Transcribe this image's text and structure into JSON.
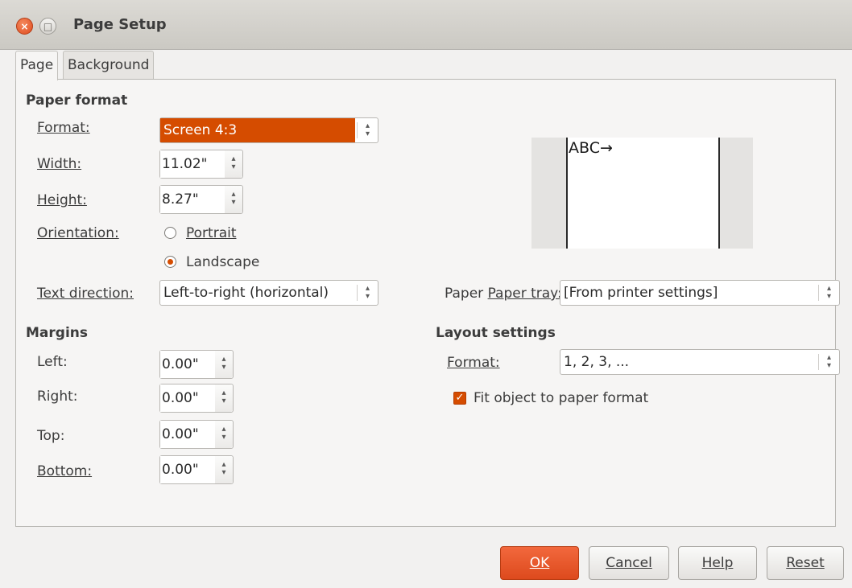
{
  "window": {
    "title": "Page Setup",
    "close_glyph": "×",
    "maximize_glyph": "□"
  },
  "tabs": [
    {
      "label": "Page",
      "active": true
    },
    {
      "label": "Background",
      "active": false
    }
  ],
  "paper_format": {
    "heading": "Paper format",
    "format_label": "Format:",
    "format_value": "Screen 4:3",
    "width_label": "Width:",
    "width_value": "11.02\"",
    "height_label": "Height:",
    "height_value": "8.27\"",
    "orientation_label": "Orientation:",
    "portrait_label": "Portrait",
    "landscape_label": "Landscape",
    "orientation_selected": "Landscape",
    "text_direction_label": "Text direction:",
    "text_direction_value": "Left-to-right (horizontal)",
    "paper_tray_label": "Paper tray:",
    "paper_tray_value": "[From printer settings]"
  },
  "preview": {
    "text": "ABC→"
  },
  "margins": {
    "heading": "Margins",
    "left_label": "Left:",
    "left_value": "0.00\"",
    "right_label": "Right:",
    "right_value": "0.00\"",
    "top_label": "Top:",
    "top_value": "0.00\"",
    "bottom_label": "Bottom:",
    "bottom_value": "0.00\""
  },
  "layout_settings": {
    "heading": "Layout settings",
    "format_label": "Format:",
    "format_value": "1, 2, 3, ...",
    "fit_label": "Fit object to paper format",
    "fit_checked": true
  },
  "buttons": {
    "ok": "OK",
    "cancel": "Cancel",
    "help": "Help",
    "reset": "Reset"
  },
  "colors": {
    "accent": "#d54c00",
    "primary_button": "#e65a2d"
  }
}
